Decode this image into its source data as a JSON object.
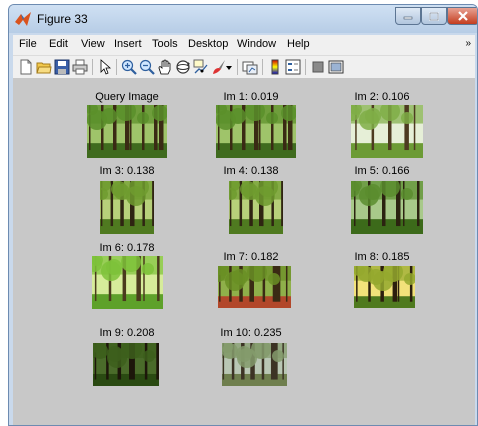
{
  "window": {
    "title": "Figure 33",
    "controls": [
      "minimize",
      "maximize",
      "close"
    ]
  },
  "menubar": {
    "items": [
      "File",
      "Edit",
      "View",
      "Insert",
      "Tools",
      "Desktop",
      "Window",
      "Help"
    ],
    "overflow": "»"
  },
  "toolbar": {
    "tools": [
      "new-figure-icon",
      "open-file-icon",
      "save-icon",
      "print-icon",
      "select-arrow-icon",
      "zoom-in-icon",
      "zoom-out-icon",
      "pan-hand-icon",
      "rotate-3d-icon",
      "data-cursor-icon",
      "brush-icon",
      "brush-dropdown-icon",
      "link-plot-icon",
      "insert-colorbar-icon",
      "insert-legend-icon",
      "hide-plot-tools-icon",
      "show-plot-tools-icon"
    ]
  },
  "figure": {
    "panels": [
      {
        "label": "Query Image",
        "scene": "forest-dense"
      },
      {
        "label": "Im 1: 0.019",
        "scene": "forest-dense"
      },
      {
        "label": "Im 2: 0.106",
        "scene": "forest-misty"
      },
      {
        "label": "Im 3: 0.138",
        "scene": "forest-tall"
      },
      {
        "label": "Im 4: 0.138",
        "scene": "forest-tall"
      },
      {
        "label": "Im 5: 0.166",
        "scene": "forest-path"
      },
      {
        "label": "Im 6: 0.178",
        "scene": "forest-bright"
      },
      {
        "label": "Im 7: 0.182",
        "scene": "forest-autumn"
      },
      {
        "label": "Im 8: 0.185",
        "scene": "forest-sunlit"
      },
      {
        "label": "Im 9: 0.208",
        "scene": "forest-dark"
      },
      {
        "label": "Im 10: 0.235",
        "scene": "forest-trail"
      }
    ]
  }
}
